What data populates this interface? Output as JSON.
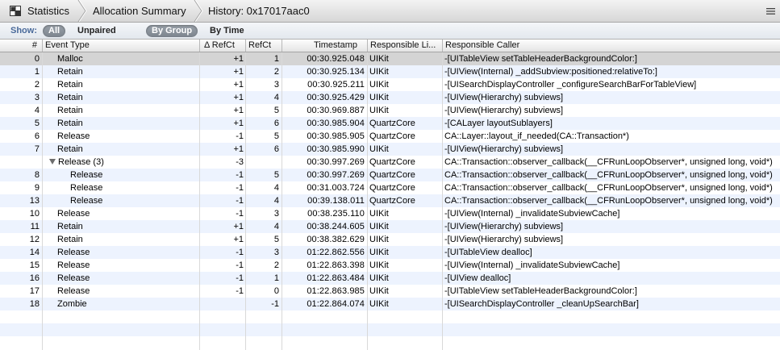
{
  "pathbar": {
    "crumbs": [
      "Statistics",
      "Allocation Summary",
      "History: 0x17017aac0"
    ]
  },
  "scopebar": {
    "show_label": "Show:",
    "all": "All",
    "unpaired": "Unpaired",
    "by_group": "By Group",
    "by_time": "By Time"
  },
  "table": {
    "columns": [
      "#",
      "Event Type",
      "Δ RefCt",
      "RefCt",
      "Timestamp",
      "Responsible Li...",
      "Responsible Caller"
    ],
    "rows": [
      {
        "num": "0",
        "event": "Malloc",
        "delta": "+1",
        "refct": "1",
        "ts": "00:30.925.048",
        "lib": "UIKit",
        "caller": "-[UITableView setTableHeaderBackgroundColor:]"
      },
      {
        "num": "1",
        "event": "Retain",
        "delta": "+1",
        "refct": "2",
        "ts": "00:30.925.134",
        "lib": "UIKit",
        "caller": "-[UIView(Internal) _addSubview:positioned:relativeTo:]"
      },
      {
        "num": "2",
        "event": "Retain",
        "delta": "+1",
        "refct": "3",
        "ts": "00:30.925.211",
        "lib": "UIKit",
        "caller": "-[UISearchDisplayController _configureSearchBarForTableView]"
      },
      {
        "num": "3",
        "event": "Retain",
        "delta": "+1",
        "refct": "4",
        "ts": "00:30.925.429",
        "lib": "UIKit",
        "caller": "-[UIView(Hierarchy) subviews]"
      },
      {
        "num": "4",
        "event": "Retain",
        "delta": "+1",
        "refct": "5",
        "ts": "00:30.969.887",
        "lib": "UIKit",
        "caller": "-[UIView(Hierarchy) subviews]"
      },
      {
        "num": "5",
        "event": "Retain",
        "delta": "+1",
        "refct": "6",
        "ts": "00:30.985.904",
        "lib": "QuartzCore",
        "caller": "-[CALayer layoutSublayers]"
      },
      {
        "num": "6",
        "event": "Release",
        "delta": "-1",
        "refct": "5",
        "ts": "00:30.985.905",
        "lib": "QuartzCore",
        "caller": "CA::Layer::layout_if_needed(CA::Transaction*)"
      },
      {
        "num": "7",
        "event": "Retain",
        "delta": "+1",
        "refct": "6",
        "ts": "00:30.985.990",
        "lib": "UIKit",
        "caller": "-[UIView(Hierarchy) subviews]"
      },
      {
        "num": "",
        "event": "Release (3)",
        "delta": "-3",
        "refct": "",
        "ts": "00:30.997.269",
        "lib": "QuartzCore",
        "caller": "CA::Transaction::observer_callback(__CFRunLoopObserver*, unsigned long, void*)",
        "group": true
      },
      {
        "num": "8",
        "event": "Release",
        "delta": "-1",
        "refct": "5",
        "ts": "00:30.997.269",
        "lib": "QuartzCore",
        "caller": "CA::Transaction::observer_callback(__CFRunLoopObserver*, unsigned long, void*)",
        "child": true
      },
      {
        "num": "9",
        "event": "Release",
        "delta": "-1",
        "refct": "4",
        "ts": "00:31.003.724",
        "lib": "QuartzCore",
        "caller": "CA::Transaction::observer_callback(__CFRunLoopObserver*, unsigned long, void*)",
        "child": true
      },
      {
        "num": "13",
        "event": "Release",
        "delta": "-1",
        "refct": "4",
        "ts": "00:39.138.011",
        "lib": "QuartzCore",
        "caller": "CA::Transaction::observer_callback(__CFRunLoopObserver*, unsigned long, void*)",
        "child": true
      },
      {
        "num": "10",
        "event": "Release",
        "delta": "-1",
        "refct": "3",
        "ts": "00:38.235.110",
        "lib": "UIKit",
        "caller": "-[UIView(Internal) _invalidateSubviewCache]"
      },
      {
        "num": "11",
        "event": "Retain",
        "delta": "+1",
        "refct": "4",
        "ts": "00:38.244.605",
        "lib": "UIKit",
        "caller": "-[UIView(Hierarchy) subviews]"
      },
      {
        "num": "12",
        "event": "Retain",
        "delta": "+1",
        "refct": "5",
        "ts": "00:38.382.629",
        "lib": "UIKit",
        "caller": "-[UIView(Hierarchy) subviews]"
      },
      {
        "num": "14",
        "event": "Release",
        "delta": "-1",
        "refct": "3",
        "ts": "01:22.862.556",
        "lib": "UIKit",
        "caller": "-[UITableView dealloc]"
      },
      {
        "num": "15",
        "event": "Release",
        "delta": "-1",
        "refct": "2",
        "ts": "01:22.863.398",
        "lib": "UIKit",
        "caller": "-[UIView(Internal) _invalidateSubviewCache]"
      },
      {
        "num": "16",
        "event": "Release",
        "delta": "-1",
        "refct": "1",
        "ts": "01:22.863.484",
        "lib": "UIKit",
        "caller": "-[UIView dealloc]"
      },
      {
        "num": "17",
        "event": "Release",
        "delta": "-1",
        "refct": "0",
        "ts": "01:22.863.985",
        "lib": "UIKit",
        "caller": "-[UITableView setTableHeaderBackgroundColor:]"
      },
      {
        "num": "18",
        "event": "Zombie",
        "delta": "",
        "refct": "-1",
        "ts": "01:22.864.074",
        "lib": "UIKit",
        "caller": "-[UISearchDisplayController _cleanUpSearchBar]"
      }
    ]
  },
  "colors": {
    "stripe": "#edf3fe",
    "selected_row": "#d4d4d4",
    "show_label": "#4a6a9a"
  }
}
